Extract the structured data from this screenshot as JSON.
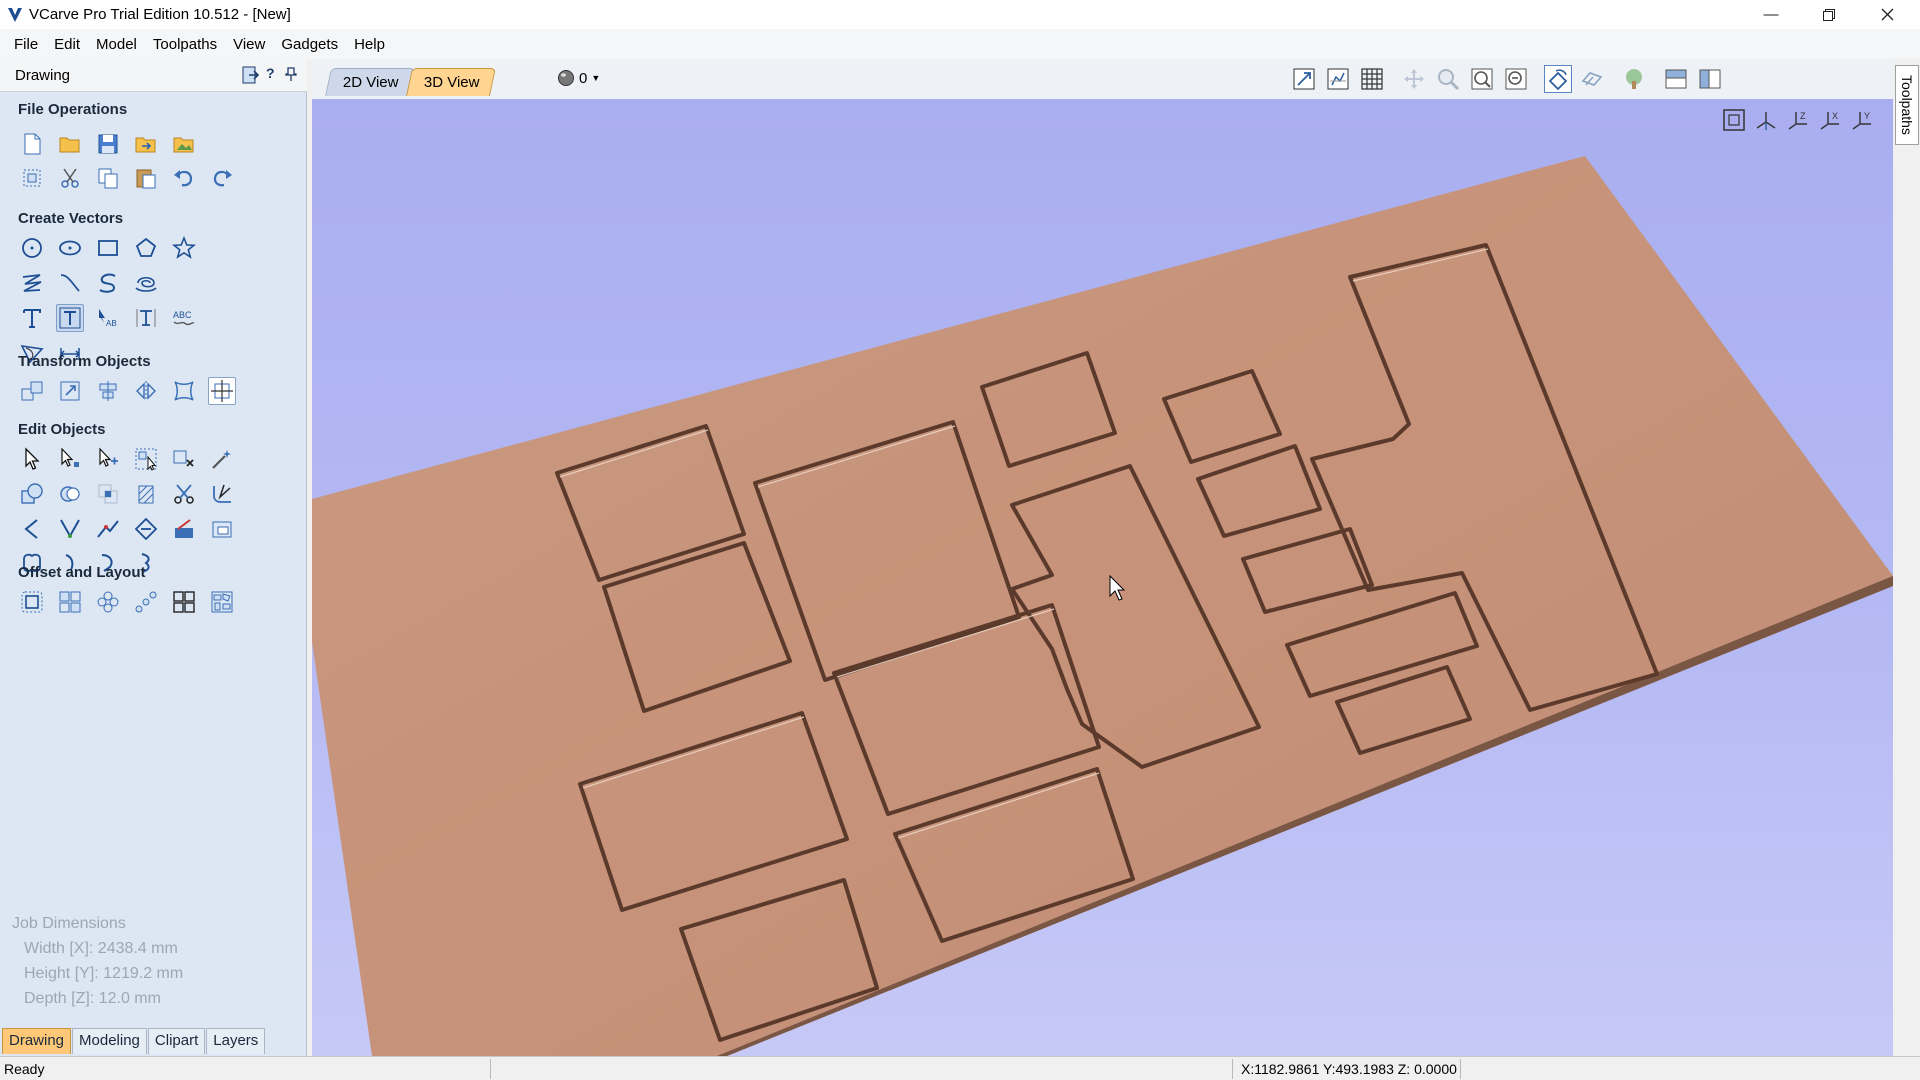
{
  "window": {
    "title": "VCarve Pro Trial Edition 10.512 - [New]",
    "minimize_icon": "minimize-icon",
    "restore_icon": "restore-icon",
    "close_icon": "close-icon"
  },
  "menu": [
    "File",
    "Edit",
    "Model",
    "Toolpaths",
    "View",
    "Gadgets",
    "Help"
  ],
  "left_panel": {
    "header": "Drawing",
    "help_label": "?",
    "sections": {
      "file_operations": "File Operations",
      "create_vectors": "Create Vectors",
      "transform_objects": "Transform Objects",
      "edit_objects": "Edit Objects",
      "offset_and_layout": "Offset and Layout"
    },
    "job_dimensions": {
      "title": "Job Dimensions",
      "width": "Width  [X]: 2438.4 mm",
      "height": "Height [Y]: 1219.2 mm",
      "depth": "Depth  [Z]: 12.0 mm"
    },
    "tabs": [
      "Drawing",
      "Modeling",
      "Clipart",
      "Layers"
    ],
    "active_tab": "Drawing"
  },
  "view": {
    "tabs": [
      "2D View",
      "3D View"
    ],
    "active_tab": "3D View",
    "material_count": "0"
  },
  "right_dock": {
    "tab": "Toolpaths"
  },
  "status": {
    "left": "Ready",
    "coords": "X:1182.9861 Y:493.1983 Z: 0.0000"
  },
  "colors": {
    "panel_bg": "#dce7f3",
    "sky": "#b5b9f4",
    "wood": "#c9967c",
    "active_tab": "#ffc878"
  }
}
